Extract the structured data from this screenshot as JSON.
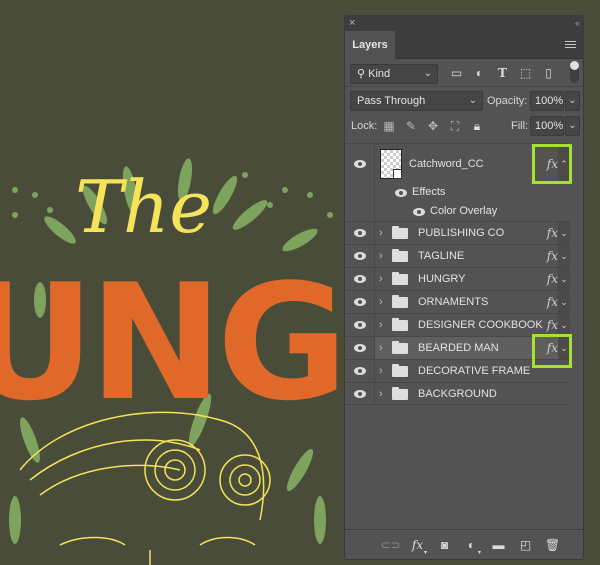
{
  "artwork": {
    "title_script": "The",
    "title_block": "UNGI",
    "background_color": "#4a4c3a",
    "accent_colors": {
      "yellow": "#f5e35a",
      "orange": "#e0692a",
      "green": "#7ea35c"
    }
  },
  "panel": {
    "close_icon": "×",
    "collapse_icon": "‹‹",
    "tab_label": "Layers",
    "filter": {
      "kind_label": "Kind",
      "icons": [
        "image-filter-icon",
        "adjustment-filter-icon",
        "type-filter-icon",
        "shape-filter-icon",
        "smart-object-filter-icon"
      ]
    },
    "blend_mode": "Pass Through",
    "opacity_label": "Opacity:",
    "opacity_value": "100%",
    "lock_label": "Lock:",
    "fill_label": "Fill:",
    "fill_value": "100%",
    "layers": [
      {
        "name": "Catchword_CC",
        "type": "smart-object",
        "fx": true,
        "expanded": true,
        "highlighted": true,
        "effects": {
          "label": "Effects",
          "items": [
            "Color Overlay"
          ]
        }
      },
      {
        "name": "PUBLISHING CO",
        "type": "group",
        "fx": true
      },
      {
        "name": "TAGLINE",
        "type": "group",
        "fx": true
      },
      {
        "name": "HUNGRY",
        "type": "group",
        "fx": true
      },
      {
        "name": "ORNAMENTS",
        "type": "group",
        "fx": true
      },
      {
        "name": "DESIGNER COOKBOOK",
        "type": "group",
        "fx": true
      },
      {
        "name": "BEARDED MAN",
        "type": "group",
        "fx": true,
        "selected": true,
        "highlighted": true
      },
      {
        "name": "DECORATIVE FRAME",
        "type": "group",
        "fx": false
      },
      {
        "name": "BACKGROUND",
        "type": "group",
        "fx": false
      }
    ],
    "fx_symbol": "fx",
    "highlight_color": "#a6e22e",
    "footer_icons": [
      "link-layers-icon",
      "add-layer-style-icon",
      "add-mask-icon",
      "adjustment-layer-icon",
      "new-group-icon",
      "new-layer-icon",
      "delete-layer-icon"
    ]
  }
}
